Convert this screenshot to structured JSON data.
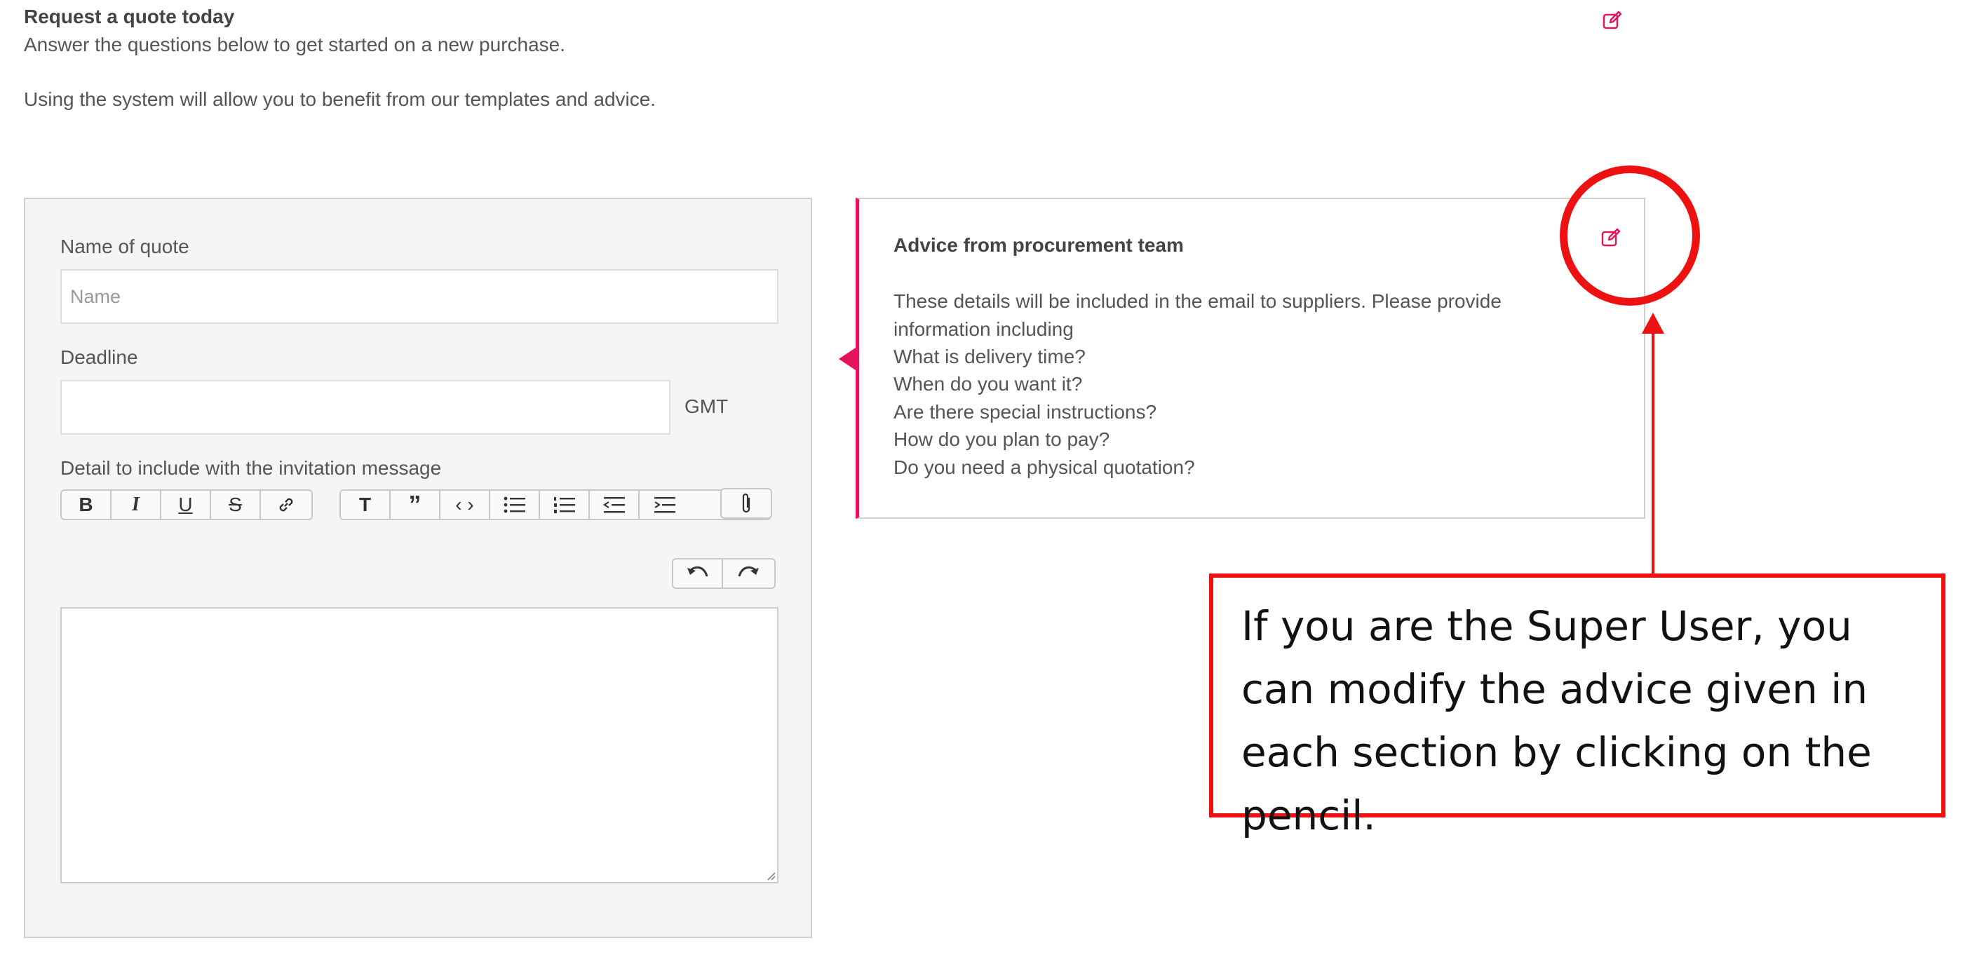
{
  "header": {
    "title": "Request a quote today",
    "subtitle": "Answer the questions below to get started on a new purchase.",
    "subtitle2": "Using the system will allow you to benefit from our templates and advice."
  },
  "form": {
    "name_label": "Name of quote",
    "name_placeholder": "Name",
    "name_value": "",
    "deadline_label": "Deadline",
    "deadline_value": "",
    "timezone": "GMT",
    "detail_label": "Detail to include with the invitation message",
    "toolbar": {
      "bold": "B",
      "italic": "I",
      "underline": "U",
      "strike": "S",
      "link": "link",
      "heading": "T",
      "quote": "”",
      "code": "‹ ›"
    }
  },
  "advice": {
    "title": "Advice from procurement team",
    "lines": [
      "These details will be included in the email to suppliers. Please provide",
      "information including",
      "What is delivery time?",
      "When do you want it?",
      "Are there special instructions?",
      "How do you plan to pay?",
      "Do you need a physical quotation?"
    ]
  },
  "annotation": {
    "text": "If you are the Super User, you can modify the advice given in each section by clicking on the pencil."
  },
  "colors": {
    "accent": "#e4145a",
    "annotation_red": "#ee1111"
  },
  "icons": {
    "edit": "pencil-edit-icon"
  }
}
